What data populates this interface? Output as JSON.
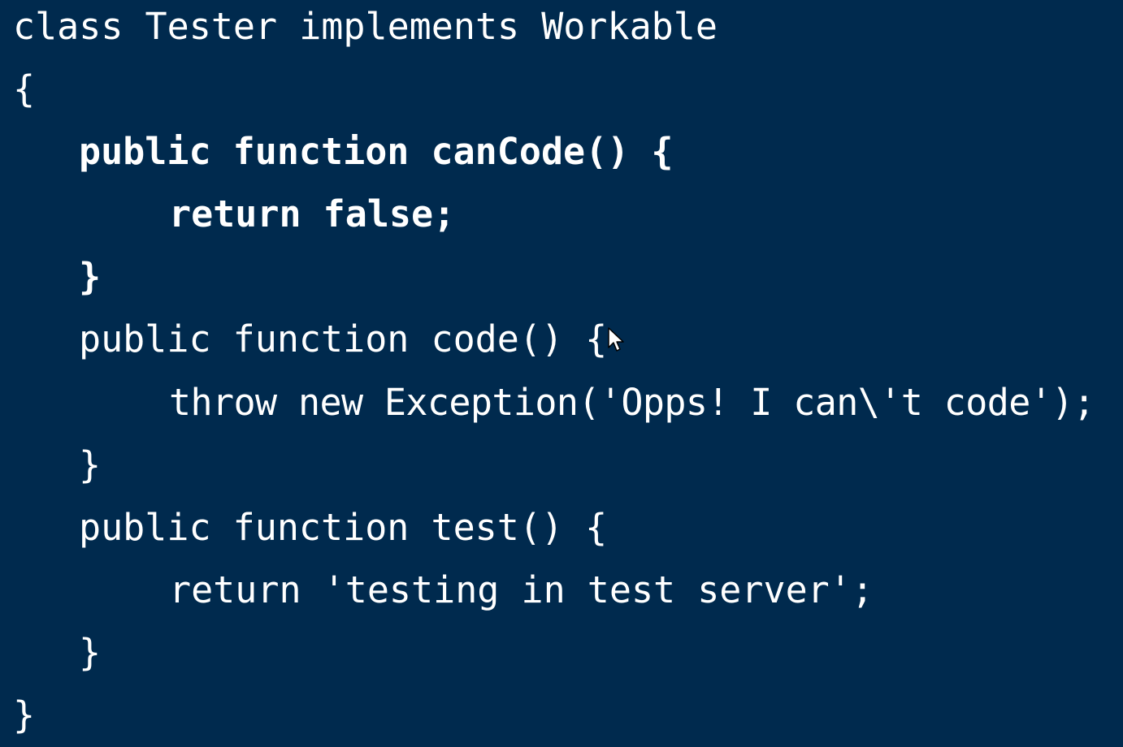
{
  "editor": {
    "background": "#002a4e",
    "text_color": "#ffffff",
    "lines": [
      "class Tester implements Workable",
      "{",
      "public function canCode() {",
      "return false;",
      "}",
      "public function code() {",
      "throw new Exception('Opps! I can\\'t code');",
      "}",
      "public function test() {",
      "return 'testing in test server';",
      "}",
      "}"
    ]
  },
  "cursor": {
    "icon": "mouse-pointer-icon"
  }
}
